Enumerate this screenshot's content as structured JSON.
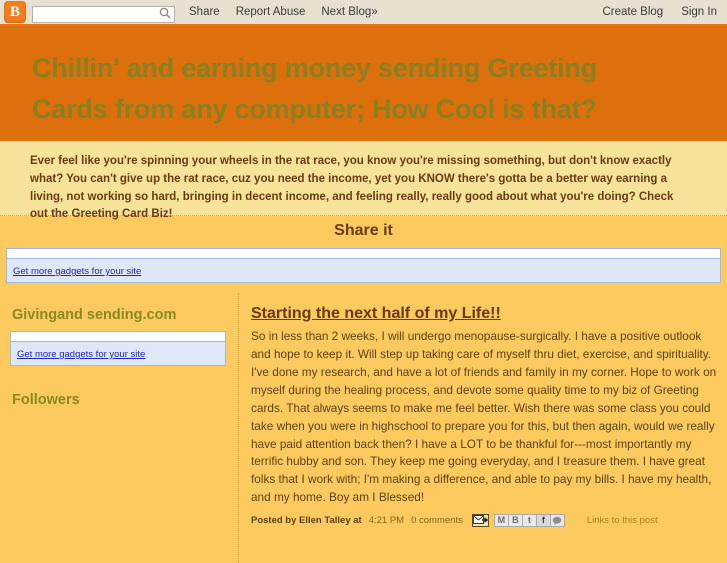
{
  "navbar": {
    "logo_letter": "B",
    "logo_name": "blogger-logo",
    "search_placeholder": "",
    "search_value": "",
    "search_icon": "search-icon",
    "links": [
      {
        "label": "Share",
        "name": "nav-link-share"
      },
      {
        "label": "Report Abuse",
        "name": "nav-link-report-abuse"
      },
      {
        "label": "Next Blog»",
        "name": "nav-link-next-blog"
      }
    ],
    "right_links": [
      {
        "label": "Create Blog",
        "name": "nav-link-create-blog"
      },
      {
        "label": "Sign In",
        "name": "nav-link-sign-in"
      }
    ]
  },
  "header": {
    "title": "Chillin' and earning money sending Greeting Cards from any computer; How Cool is that?",
    "description": "Ever feel like you're spinning your wheels in the rat race, you know you're missing something, but don't know exactly what? You can't give up the rat race, cuz you need the income, yet you KNOW there's gotta be a better way earning a living, not working so hard, bringing in decent income, and feeling really, really good about what you're doing? Check out the Greeting Card Biz!"
  },
  "crosscol": {
    "title": "Share it",
    "gadget_link": "Get more gadgets for your site"
  },
  "sidebar": {
    "gadgets": [
      {
        "title": "Givingand sending.com",
        "link": "Get more gadgets for your site"
      }
    ],
    "followers_title": "Followers"
  },
  "post": {
    "title": "Starting the next half of my Life!!",
    "body": "So in less than 2 weeks, I will undergo menopause-surgically.  I have a positive outlook and hope to keep it.  Will step up taking care of myself thru diet, exercise, and spirituality.  I've done my research, and have a lot of friends and family in my corner.  Hope to work on myself during the healing process, and devote some quality time to my biz of Greeting cards.  That always seems to make me feel better.  Wish there was some class you could take when you were in highschool to prepare you for this, but then again, would we really have paid attention back then?  I have a LOT to be thankful for---most importantly my terrific hubby and son.  They keep me going everyday, and I treasure them.  I have great folks that I work with; I'm making a difference, and able to pay my bills.  I have my health, and my home.  Boy am I Blessed!",
    "posted_by": "Posted by Ellen Talley at",
    "time": "4:21 PM",
    "comments": "0 comments",
    "links_to_post": "Links to this post",
    "share_icons": [
      {
        "name": "email-post-icon",
        "glyph": ""
      },
      {
        "name": "gmail-share-icon",
        "glyph": "M"
      },
      {
        "name": "blogger-share-icon",
        "glyph": "B"
      },
      {
        "name": "twitter-share-icon",
        "glyph": "t"
      },
      {
        "name": "facebook-share-icon",
        "glyph": "f"
      },
      {
        "name": "buzz-share-icon",
        "glyph": ""
      }
    ]
  },
  "colors": {
    "page_bg": "#fcca5e",
    "header_bg": "#dd6f0c",
    "header_title": "#8a8020",
    "description_bg": "#f7e49a",
    "navbar_bg": "#e8e0d0",
    "accent_orange": "#e8741b",
    "sidebar_heading": "#8a8a1f",
    "post_text": "#5d4114",
    "link_blue": "#2222cc"
  }
}
